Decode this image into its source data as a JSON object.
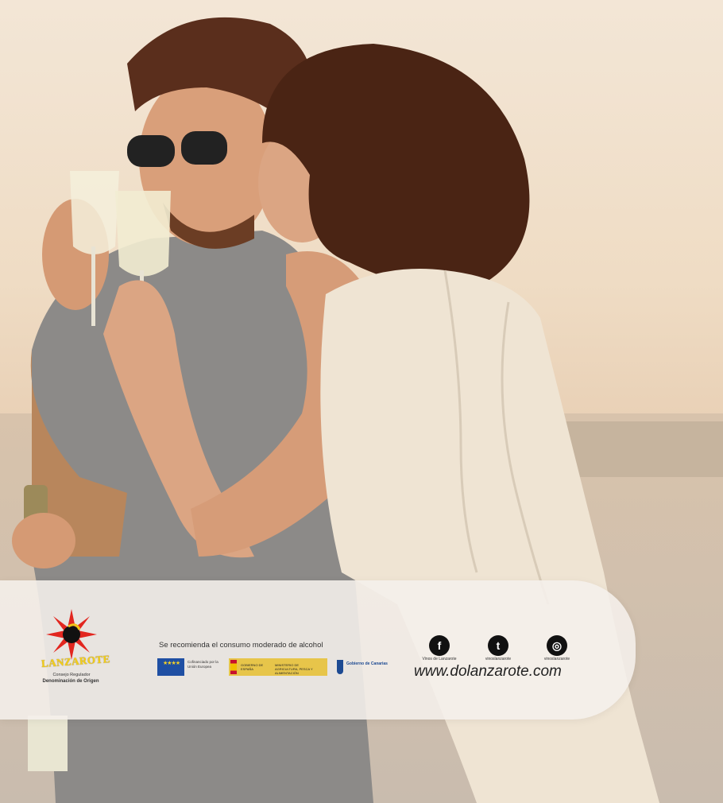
{
  "photo": {
    "subject": "couple-with-wine-glasses",
    "colors": {
      "sky": "#f3e6d6",
      "skin": "#d99f7a",
      "hair_man": "#5a2e1c",
      "hair_woman": "#4a2414",
      "jacket": "#8c8a88",
      "knit_top": "#efe4d3"
    }
  },
  "banner": {
    "logo": {
      "wordmark": "LANZAROTE",
      "line1": "Consejo Regulador",
      "line2": "Denominación de Origen"
    },
    "notice": "Se recomienda el consumo moderado de alcohol",
    "eu_text": "Cofinanciado por la Unión Europea",
    "es_text1": "GOBIERNO DE ESPAÑA",
    "es_text2": "MINISTERIO DE AGRICULTURA, PESCA Y ALIMENTACIÓN",
    "canarias_text": "Gobierno de Canarias",
    "social": [
      {
        "icon": "facebook-icon",
        "glyph": "f",
        "label": "Vinos de Lanzarote"
      },
      {
        "icon": "twitter-icon",
        "glyph": "t",
        "label": "vinoslanzarote"
      },
      {
        "icon": "instagram-icon",
        "glyph": "◎",
        "label": "vinoslanzarote"
      }
    ],
    "url": "www.dolanzarote.com"
  }
}
